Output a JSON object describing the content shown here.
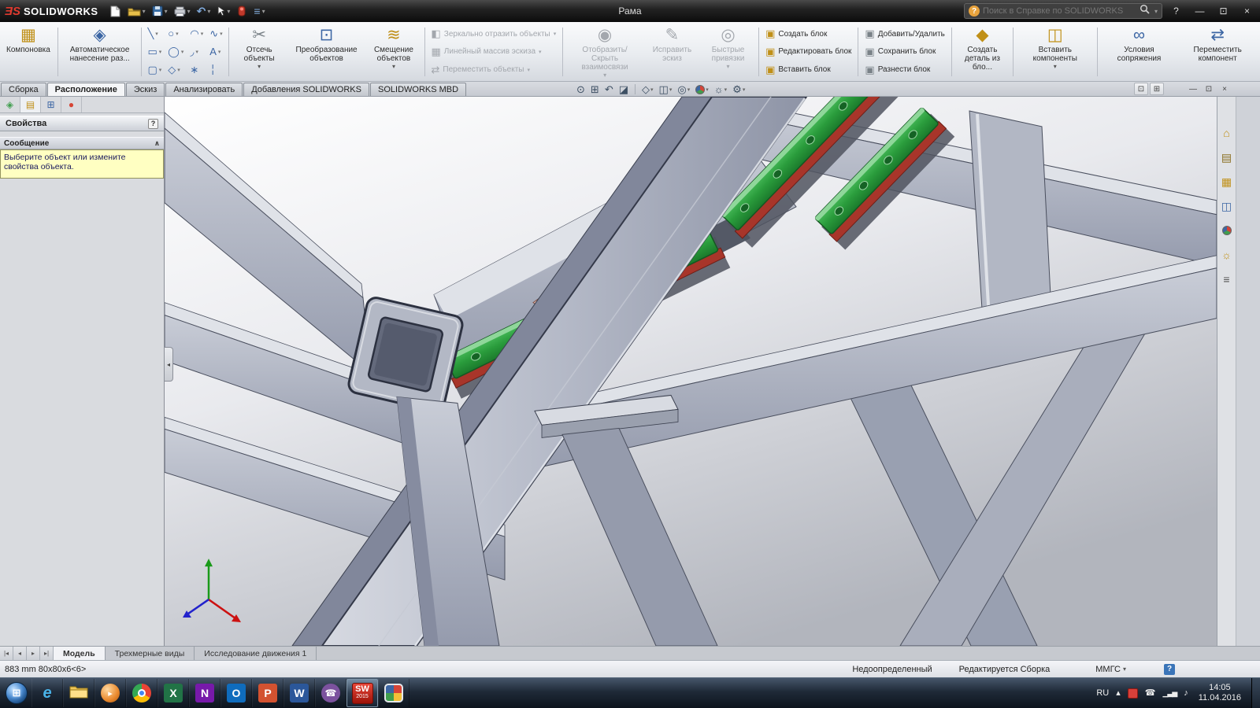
{
  "colors": {
    "rail_green": "#2e9e3e",
    "rail_base_red": "#a8352a",
    "beam_gray": "#a9aebc",
    "message_yellow": "#ffffc2",
    "titlebar_black": "#161616",
    "taskbar_dark_blue": "#1f2a38",
    "solidworks_red": "#c0392b"
  },
  "title_bar": {
    "logo_badge": "ƎS",
    "logo_text": "SOLIDWORKS",
    "doc_title": "Рама",
    "search_placeholder": "Поиск в Справке по SOLIDWORKS",
    "help": "?"
  },
  "ribbon_tabs": {
    "assembly": "Сборка",
    "layout": "Расположение",
    "sketch": "Эскиз",
    "evaluate": "Анализировать",
    "addins": "Добавления SOLIDWORKS",
    "mbd": "SOLIDWORKS MBD"
  },
  "ribbon": {
    "layout_tool": "Компоновка",
    "autodimension": "Автоматическое нанесение раз...",
    "trim": "Отсечь объекты",
    "convert": "Преобразование объектов",
    "offset": "Смещение объектов",
    "mirror": "Зеркально отразить объекты",
    "linear_pattern": "Линейный массив эскиза",
    "move_entities": "Переместить объекты",
    "display_relations": "Отобразить/Скрыть взаимосвязи",
    "repair_sketch": "Исправить эскиз",
    "quick_snaps": "Быстрые привязки",
    "make_block": "Создать блок",
    "edit_block": "Редактировать блок",
    "insert_block": "Вставить блок",
    "add_remove": "Добавить/Удалить",
    "save_block": "Сохранить блок",
    "explode_block": "Разнести блок",
    "make_part_from_block": "Создать деталь из бло...",
    "insert_components": "Вставить компоненты",
    "mate": "Условия сопряжения",
    "move_component": "Переместить компонент"
  },
  "left_panel": {
    "properties_title": "Свойства",
    "help_badge": "?",
    "message_header": "Сообщение",
    "message_text": "Выберите объект или измените свойства объекта."
  },
  "model_tabs": {
    "model": "Модель",
    "views_3d": "Трехмерные виды",
    "motion_study": "Исследование движения 1"
  },
  "status_bar": {
    "dimensions": "883 mm 80x80x6<6>",
    "state": "Недоопределенный",
    "mode": "Редактируется Сборка",
    "units": "ММГС",
    "help": "?"
  },
  "taskbar": {
    "language": "RU",
    "time": "14:05",
    "date": "11.04.2016",
    "sw_label": "SW",
    "sw_year": "2015",
    "ie": "e",
    "excel": "X",
    "onenote": "N",
    "outlook": "O",
    "powerpoint": "P",
    "word": "W"
  },
  "glyphs": {
    "dropdown": "▾",
    "chevron_up": "∧",
    "panel_collapse": "◂",
    "minimize": "—",
    "restore": "⊡",
    "close": "×",
    "help_q": "?",
    "line": "╲",
    "circle": "○",
    "arc": "◠",
    "spline": "∿",
    "rectangle": "▭",
    "ellipse": "◯",
    "fillet": "◞",
    "text_tool": "А",
    "slot": "▢",
    "polygon": "◇",
    "point": "∗",
    "centerline": "╎",
    "layout_tool": "▦",
    "autodimension": "◈",
    "trim": "✂",
    "convert": "⊡",
    "offset": "≋",
    "mirror": "◧",
    "linear_pattern": "▦",
    "move_entities": "⇄",
    "display_relations": "◉",
    "repair_sketch": "✎",
    "quick_snaps": "◎",
    "block": "▣",
    "make_part": "◆",
    "insert_components": "◫",
    "mate": "∞",
    "move_component": "⇄",
    "zoom_fit": "⊙",
    "zoom_area": "⊞",
    "prev_view": "↶",
    "section": "◪",
    "orientation": "◇",
    "display_style": "◫",
    "hide_show": "◎",
    "scene": "☼",
    "gear": "⚙",
    "undo": "↶",
    "options": "≡",
    "nav_first": "|◂",
    "nav_prev": "◂",
    "nav_next": "▸",
    "nav_last": "▸|",
    "tray_up": "▴",
    "phone": "☎",
    "signal": "▁▃▅",
    "note": "♪",
    "start": "⊞",
    "play": "▸",
    "tab_feature": "◈",
    "tab_property": "▤",
    "tab_config": "⊞",
    "tab_display": "●",
    "tp_home": "⌂",
    "tp_library": "▤",
    "tp_explorer": "▦",
    "tp_palette": "◫",
    "tp_scene": "☼",
    "tp_props": "≡"
  }
}
